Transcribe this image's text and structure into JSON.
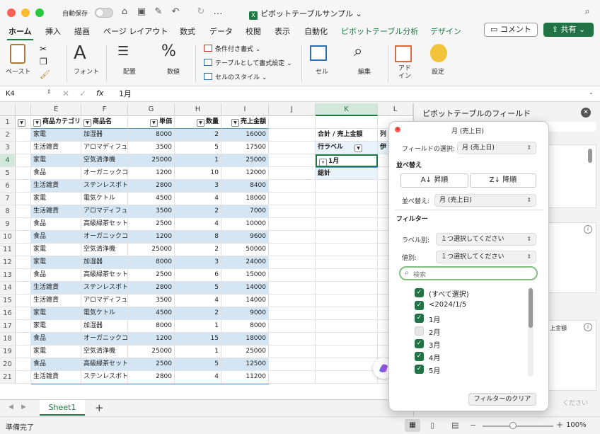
{
  "titlebar": {
    "autosave": "自動保存",
    "doc_title": "ピボットテーブルサンプル"
  },
  "tabs": [
    "ホーム",
    "挿入",
    "描画",
    "ページ レイアウト",
    "数式",
    "データ",
    "校閲",
    "表示",
    "自動化",
    "ピボットテーブル分析",
    "デザイン"
  ],
  "buttons": {
    "comment": "コメント",
    "share": "共有"
  },
  "ribbon": {
    "paste": "ペースト",
    "font": "フォント",
    "align": "配置",
    "number": "数値",
    "cond1": "条件付き書式",
    "cond2": "テーブルとして書式設定",
    "cond3": "セルのスタイル",
    "cell": "セル",
    "edit": "編集",
    "addin": "アド\nイン",
    "settings": "設定"
  },
  "formula": {
    "namebox": "K4",
    "content": "1月",
    "fx": "fx"
  },
  "columns": [
    "E",
    "F",
    "G",
    "H",
    "I",
    "J",
    "K",
    "L"
  ],
  "headers": [
    "商品カテゴリ",
    "商品名",
    "単価",
    "数量",
    "売上金額"
  ],
  "rows": [
    [
      "家電",
      "加湿器",
      "8000",
      "2",
      "16000"
    ],
    [
      "生活雑貨",
      "アロマディフュ·",
      "3500",
      "5",
      "17500"
    ],
    [
      "家電",
      "空気清浄機",
      "25000",
      "1",
      "25000"
    ],
    [
      "食品",
      "オーガニックコ·",
      "1200",
      "10",
      "12000"
    ],
    [
      "生活雑貨",
      "ステンレスボト.",
      "2800",
      "3",
      "8400"
    ],
    [
      "家電",
      "電気ケトル",
      "4500",
      "4",
      "18000"
    ],
    [
      "生活雑貨",
      "アロマディフュ·",
      "3500",
      "2",
      "7000"
    ],
    [
      "食品",
      "高級緑茶セット",
      "2500",
      "4",
      "10000"
    ],
    [
      "食品",
      "オーガニックコ·",
      "1200",
      "8",
      "9600"
    ],
    [
      "家電",
      "空気清浄機",
      "25000",
      "2",
      "50000"
    ],
    [
      "家電",
      "加湿器",
      "8000",
      "3",
      "24000"
    ],
    [
      "食品",
      "高級緑茶セット",
      "2500",
      "6",
      "15000"
    ],
    [
      "生活雑貨",
      "ステンレスボト.",
      "2800",
      "5",
      "14000"
    ],
    [
      "生活雑貨",
      "アロマディフュ·",
      "3500",
      "4",
      "14000"
    ],
    [
      "家電",
      "電気ケトル",
      "4500",
      "2",
      "9000"
    ],
    [
      "家電",
      "加湿器",
      "8000",
      "1",
      "8000"
    ],
    [
      "食品",
      "オーガニックコ·",
      "1200",
      "15",
      "18000"
    ],
    [
      "家電",
      "空気清浄機",
      "25000",
      "1",
      "25000"
    ],
    [
      "食品",
      "高級緑茶セット",
      "2500",
      "5",
      "12500"
    ],
    [
      "生活雑貨",
      "ステンレスボト.",
      "2800",
      "4",
      "11200"
    ]
  ],
  "pivot": {
    "k2": "合計 / 売上金額",
    "l2": "列",
    "k3": "行ラベル",
    "l3": "伊",
    "k4": "1月",
    "k5": "総計"
  },
  "sheet": {
    "name": "Sheet1",
    "add": "+"
  },
  "status": {
    "ready": "準備完了",
    "zoom": "100%"
  },
  "pane": {
    "title": "ピボットテーブルのフィールド",
    "field_label": "上金額",
    "hint": "ください"
  },
  "popup": {
    "title": "月 (売上日)",
    "field_select_label": "フィールドの選択:",
    "field_select_value": "月 (売上日)",
    "sort_section": "並べ替え",
    "asc": "昇順",
    "desc": "降順",
    "sort_by_label": "並べ替え:",
    "sort_by_value": "月 (売上日)",
    "filter_section": "フィルター",
    "label_filter": "ラベル別:",
    "label_filter_value": "１つ選択してください",
    "value_filter": "値別:",
    "value_filter_value": "１つ選択してください",
    "search_placeholder": "検索",
    "items": [
      {
        "label": "(すべて選択)",
        "checked": true
      },
      {
        "label": "<2024/1/5",
        "checked": true
      },
      {
        "label": "1月",
        "checked": true
      },
      {
        "label": "2月",
        "checked": false
      },
      {
        "label": "3月",
        "checked": true
      },
      {
        "label": "4月",
        "checked": true
      },
      {
        "label": "5月",
        "checked": true
      }
    ],
    "clear": "フィルターのクリア"
  }
}
